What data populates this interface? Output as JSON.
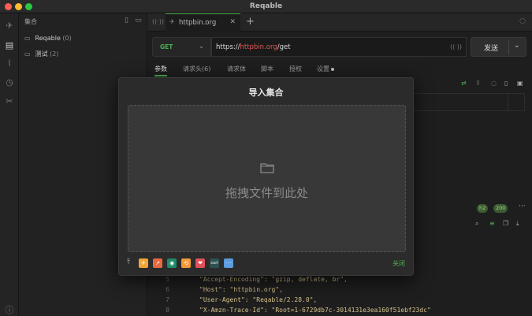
{
  "window": {
    "title": "Reqable",
    "traffic_lights": {
      "close": "#ff5f57",
      "minimize": "#febc2e",
      "zoom": "#28c840"
    }
  },
  "sidebar": {
    "title": "集合",
    "items": [
      {
        "label": "Reqable",
        "count": "(0)"
      },
      {
        "label": "测试",
        "count": "(2)"
      }
    ]
  },
  "tabs": [
    {
      "label": "httpbin.org"
    }
  ],
  "request": {
    "method": "GET",
    "url_prefix": "https://",
    "url_host": "httpbin.org",
    "url_path": "/get",
    "send_label": "发送"
  },
  "request_tabs": [
    {
      "label": "参数",
      "active": true
    },
    {
      "label": "请求头(6)"
    },
    {
      "label": "请求体"
    },
    {
      "label": "脚本"
    },
    {
      "label": "授权"
    },
    {
      "label": "设置"
    }
  ],
  "response": {
    "badges": [
      "h2",
      "200"
    ],
    "more": "···",
    "code_lines": [
      {
        "n": "5",
        "text": "\"Accept-Encoding\": \"gzip, deflate, br\","
      },
      {
        "n": "6",
        "text": "\"Host\": \"httpbin.org\","
      },
      {
        "n": "7",
        "text": "\"User-Agent\": \"Reqable/2.28.0\","
      },
      {
        "n": "8",
        "text": "\"X-Amzn-Trace-Id\": \"Root=1-6729db7c-3014131e3ea160f51ebf23dc\""
      }
    ]
  },
  "modal": {
    "title": "导入集合",
    "drop_text": "拖拽文件到此处",
    "close_label": "关闭",
    "import_sources": [
      {
        "name": "postman-icon",
        "color": "#f0a53a",
        "glyph": "✈"
      },
      {
        "name": "insomnia-icon",
        "color": "#e8683f",
        "glyph": "↗"
      },
      {
        "name": "eye-icon",
        "color": "#1f8a6a",
        "glyph": "◉"
      },
      {
        "name": "swagger-icon",
        "color": "#f39a37",
        "glyph": "⟲"
      },
      {
        "name": "pocket-icon",
        "color": "#e0505a",
        "glyph": "❤"
      },
      {
        "name": "curl-icon",
        "color": "#2f5050",
        "glyph": "curl"
      },
      {
        "name": "har-icon",
        "color": "#5b9bdf",
        "glyph": "···"
      }
    ]
  }
}
